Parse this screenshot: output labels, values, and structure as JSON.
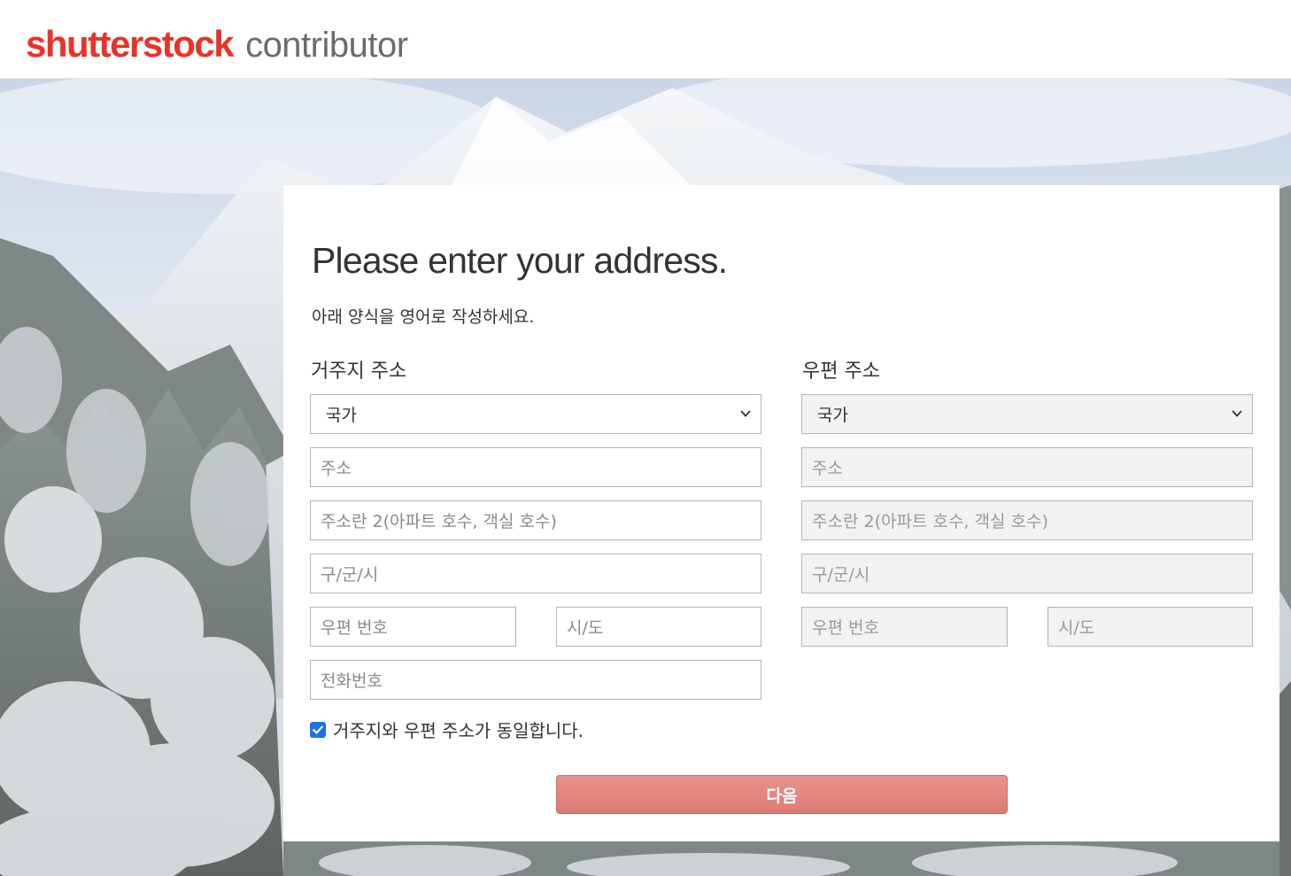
{
  "brand": {
    "name": "shutterstock",
    "product": "contributor"
  },
  "form": {
    "title": "Please enter your address.",
    "subtitle": "아래 양식을 영어로 작성하세요.",
    "residential": {
      "heading": "거주지 주소",
      "country": "국가",
      "address": "주소",
      "address2": "주소란 2(아파트 호수, 객실 호수)",
      "city": "구/군/시",
      "postal": "우편 번호",
      "state": "시/도",
      "phone": "전화번호"
    },
    "postal": {
      "heading": "우편 주소",
      "country": "국가",
      "address": "주소",
      "address2": "주소란 2(아파트 호수, 객실 호수)",
      "city": "구/군/시",
      "postal": "우편 번호",
      "state": "시/도"
    },
    "same_address_label": "거주지와 우편 주소가 동일합니다.",
    "same_address_checked": true,
    "next_label": "다음"
  },
  "colors": {
    "brand_red": "#e8332a",
    "button": "#e08680",
    "checkbox": "#1a73e8"
  }
}
